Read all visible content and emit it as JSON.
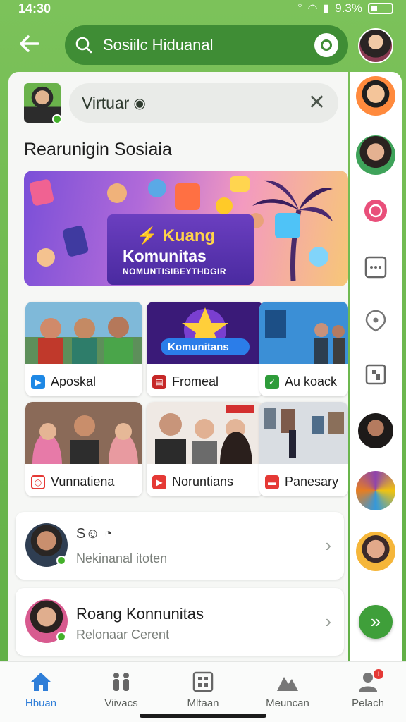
{
  "status_bar": {
    "time": "14:30",
    "battery": "9.3%"
  },
  "top_bar": {
    "search_text": "Sosiilc Hiduanal"
  },
  "panel": {
    "search_value": "Virtuar",
    "section_title": "Rearunigin Sosiaia"
  },
  "banner": {
    "title_line1": "Kuang",
    "title_line2": "Komunitas",
    "subtitle": "NOMUNTISIBEYTHDGIR"
  },
  "grid": [
    {
      "label": "Aposkal",
      "icon_color": "#1e88e5"
    },
    {
      "label": "Fromeal",
      "icon_color": "#c62828"
    },
    {
      "label": "Au koack",
      "icon_color": "#2e9c3a"
    },
    {
      "label": "Vunnatiena",
      "icon_color": "#e53935"
    },
    {
      "label": "Noruntians",
      "icon_color": "#e53935"
    },
    {
      "label": "Panesary",
      "icon_color": "#e53935"
    }
  ],
  "grid_overlays": {
    "komunitas_thumb": "Komunitans"
  },
  "list": [
    {
      "title": "S☺ ◔",
      "subtitle": "Nekinanal itoten"
    },
    {
      "title": "Roang Konnunitas",
      "subtitle": "Relonaar Cerent"
    }
  ],
  "bottom_nav": [
    {
      "label": "Hbuan",
      "icon": "home-icon",
      "active": true
    },
    {
      "label": "Viivacs",
      "icon": "people-icon",
      "active": false
    },
    {
      "label": "Mltaan",
      "icon": "grid-icon",
      "active": false
    },
    {
      "label": "Meuncan",
      "icon": "landscape-icon",
      "active": false
    },
    {
      "label": "Pelach",
      "icon": "profile-icon",
      "active": false
    }
  ],
  "colors": {
    "brand_green": "#5fae45",
    "dark_green": "#3f8d35",
    "active_blue": "#2f7ed8"
  }
}
